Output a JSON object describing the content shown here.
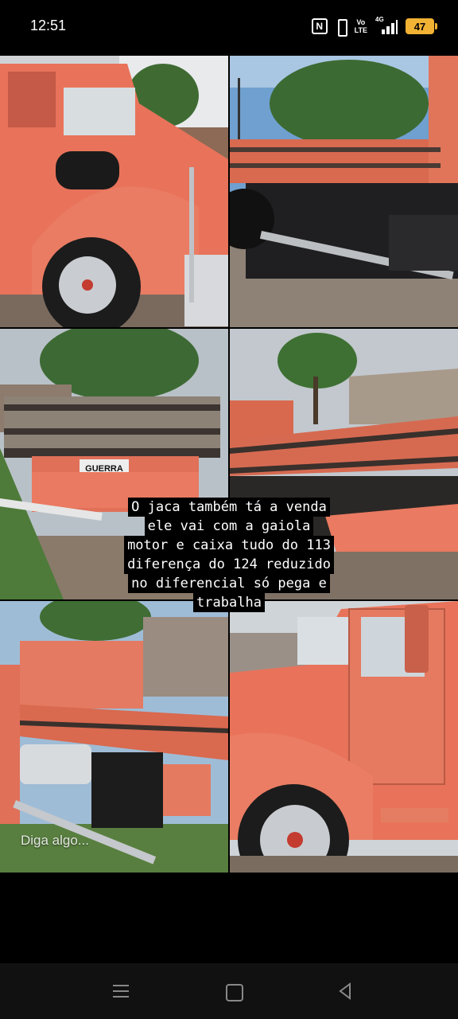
{
  "status_bar": {
    "time": "12:51",
    "icons": [
      "nfc-icon",
      "vibrate-icon",
      "volte-icon",
      "signal-4g-icon",
      "battery-icon"
    ],
    "nfc_label": "N",
    "volte_line1": "Vo",
    "volte_line2": "LTE",
    "network_label": "4G",
    "battery_level": "47",
    "battery_color": "#f2b233"
  },
  "story": {
    "caption_lines": [
      "O jaca também tá a venda",
      "ele vai com a gaiola",
      "motor e caixa tudo do 113",
      "diferença do 124 reduzido",
      "no diferencial só pega e",
      "trabalha"
    ],
    "photo_text": {
      "plate_sign": "GUERRA"
    },
    "reply_placeholder": "Diga algo..."
  },
  "nav_bar": {
    "buttons": [
      "menu-icon",
      "home-icon",
      "back-icon"
    ]
  },
  "colors": {
    "truck_orange": "#e8735a",
    "background": "#000000"
  }
}
